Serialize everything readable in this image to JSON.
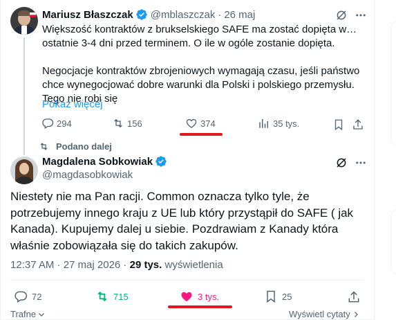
{
  "quoted_tweet": {
    "author_name": "Mariusz Błaszczak",
    "handle": "@mblaszczak",
    "date": "26 maj",
    "text_p1": "Większość kontraktów z brukselskiego SAFE ma zostać dopięta w… ostatnie 3-4 dni przed terminem. O ile w ogóle zostanie dopięta.",
    "text_p2": "Negocjacje kontraktów zbrojeniowych wymagają czasu, jeśli państwo chce wynegocjować dobre warunki dla Polski i polskiego przemysłu. Tego nie robi się",
    "show_more": "Pokaż więcej",
    "replies": "294",
    "reposts": "156",
    "likes": "374",
    "views": "35 tys."
  },
  "main_tweet": {
    "reposted_label": "Podano dalej",
    "author_name": "Magdalena Sobkowiak",
    "handle": "@magdasobkowiak",
    "text": "Niestety nie ma Pan racji. Common oznacza tylko tyle, że potrzebujemy innego kraju z UE lub który przystąpił do SAFE ( jak Kanada). Kupujemy dalej u siebie. Pozdrawiam z Kanady która właśnie zobowiązała się do takich zakupów.",
    "timestamp": "12:37 AM · 27 maj 2026 · ",
    "views_count": "29 tys.",
    "views_label": "wyświetlenia",
    "replies": "72",
    "reposts": "715",
    "likes": "3 tys.",
    "bookmarks": "25"
  },
  "footer": {
    "left_label": "Trafne",
    "right_label": "Wyświetl cytaty"
  },
  "colors": {
    "accent": "#1d9bf0",
    "like": "#f91880",
    "repost": "#00ba7c",
    "highlight": "#e3171d",
    "muted": "#536471"
  }
}
